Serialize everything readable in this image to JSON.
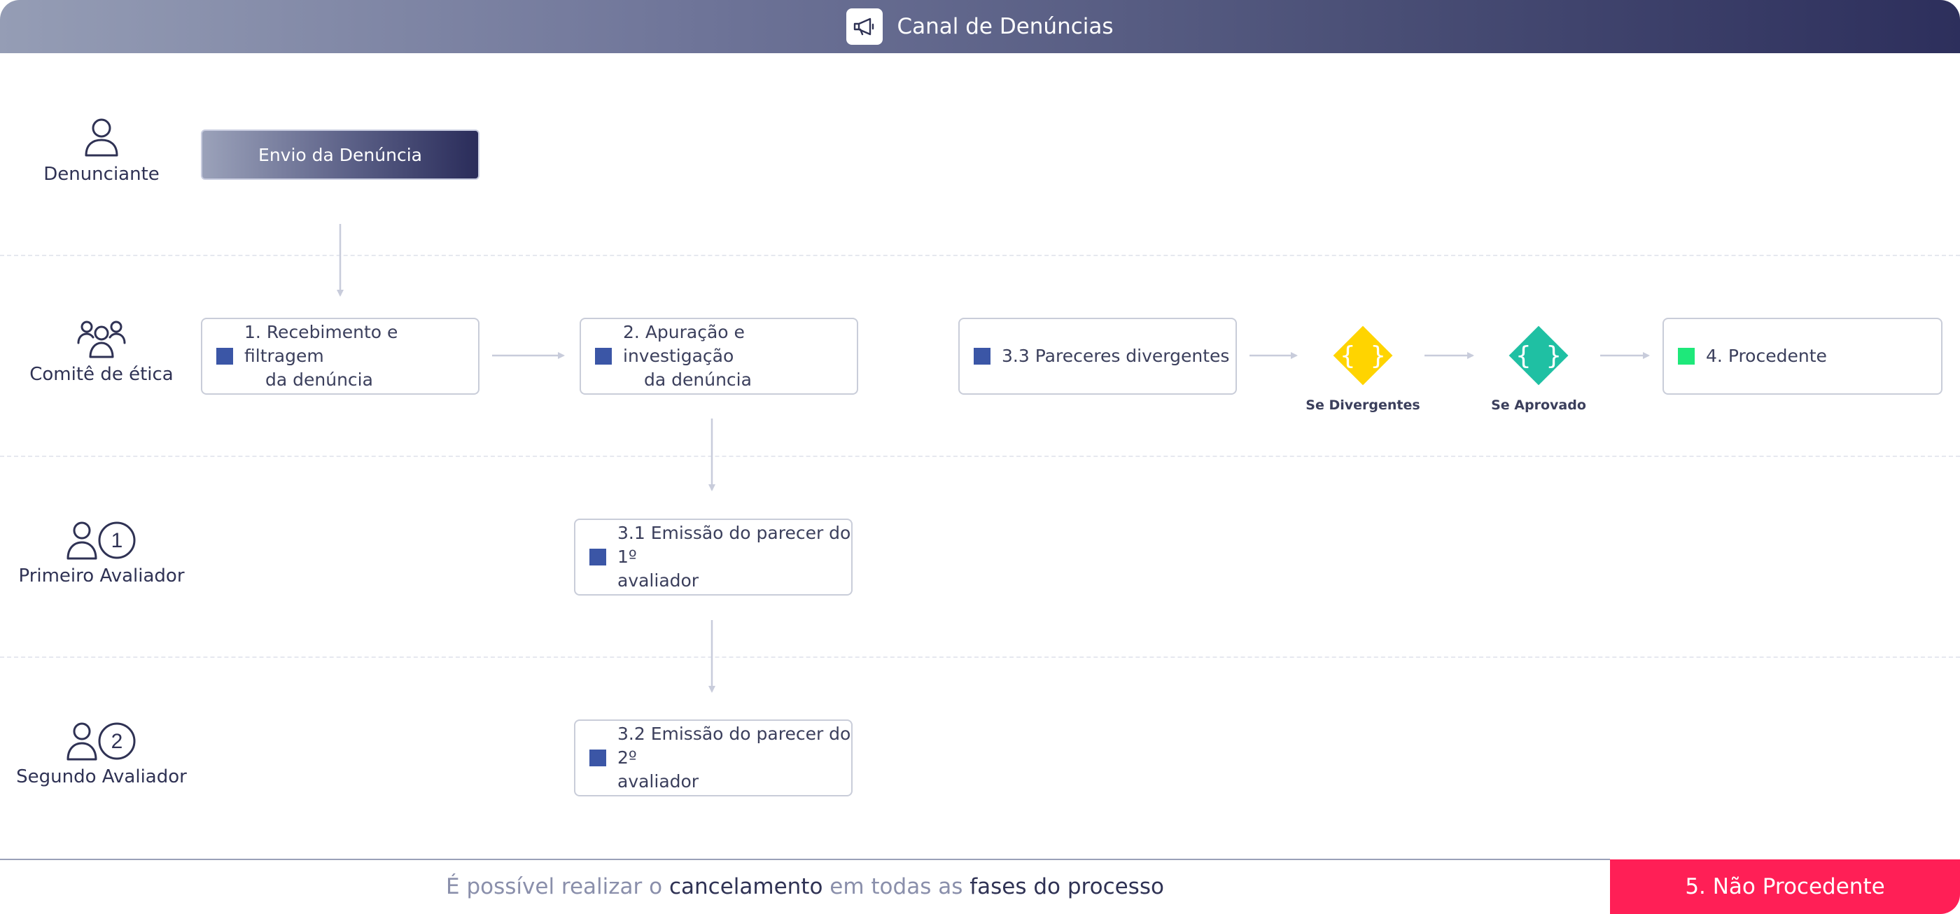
{
  "header": {
    "title": "Canal de Denúncias",
    "icon": "megaphone-icon"
  },
  "lanes": [
    {
      "label": "Denunciante",
      "icon": "person-icon"
    },
    {
      "label": "Comitê de ética",
      "icon": "group-icon"
    },
    {
      "label": "Primeiro Avaliador",
      "icon": "person-one-icon",
      "badge": "1"
    },
    {
      "label": "Segundo Avaliador",
      "icon": "person-two-icon",
      "badge": "2"
    }
  ],
  "start": {
    "label": "Envio da Denúncia"
  },
  "tasks": {
    "t1": {
      "num": "1.",
      "line1": "Recebimento e filtragem",
      "line2": "da denúncia"
    },
    "t2": {
      "num": "2.",
      "line1": "Apuração e investigação",
      "line2": "da denúncia"
    },
    "t31": {
      "line1": "3.1 Emissão do parecer do 1º",
      "line2": "avaliador"
    },
    "t32": {
      "line1": "3.2 Emissão do parecer do 2º",
      "line2": "avaliador"
    },
    "t33": {
      "label": "3.3 Pareceres divergentes"
    },
    "t4": {
      "num": "4.",
      "label": "Procedente"
    }
  },
  "gateways": [
    {
      "label": "Se Divergentes",
      "color": "#ffd400"
    },
    {
      "label": "Se Aprovado",
      "color": "#1fc0a3"
    }
  ],
  "colors": {
    "task_marker": "#3b56a6",
    "success_marker": "#1ee87a",
    "danger": "#ff1f56"
  },
  "footer": {
    "text_part1": "É possível realizar o",
    "text_part2": "cancelamento",
    "text_part3": "em todas as",
    "text_part4": "fases do processo",
    "button_label": "5. Não Procedente"
  }
}
